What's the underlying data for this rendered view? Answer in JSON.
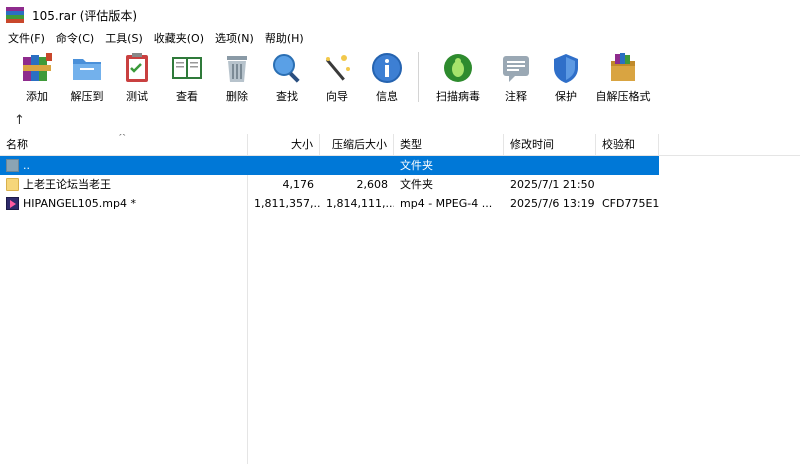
{
  "window": {
    "title": "105.rar (评估版本)"
  },
  "menu": [
    {
      "label": "文件(F)",
      "name": "menu-file"
    },
    {
      "label": "命令(C)",
      "name": "menu-commands"
    },
    {
      "label": "工具(S)",
      "name": "menu-tools"
    },
    {
      "label": "收藏夹(O)",
      "name": "menu-favorites"
    },
    {
      "label": "选项(N)",
      "name": "menu-options"
    },
    {
      "label": "帮助(H)",
      "name": "menu-help"
    }
  ],
  "toolbar": [
    {
      "label": "添加",
      "icon": "books-add-icon"
    },
    {
      "label": "解压到",
      "icon": "folder-extract-icon"
    },
    {
      "label": "测试",
      "icon": "clipboard-test-icon"
    },
    {
      "label": "查看",
      "icon": "book-view-icon"
    },
    {
      "label": "删除",
      "icon": "trash-icon"
    },
    {
      "label": "查找",
      "icon": "magnifier-icon"
    },
    {
      "label": "向导",
      "icon": "magic-wand-icon"
    },
    {
      "label": "信息",
      "icon": "info-icon"
    },
    {
      "label": "扫描病毒",
      "icon": "bug-scan-icon"
    },
    {
      "label": "注释",
      "icon": "comment-icon"
    },
    {
      "label": "保护",
      "icon": "shield-icon"
    },
    {
      "label": "自解压格式",
      "icon": "sfx-box-icon"
    }
  ],
  "columns": {
    "name": "名称",
    "size": "大小",
    "packed": "压缩后大小",
    "type": "类型",
    "modified": "修改时间",
    "crc": "校验和"
  },
  "files": [
    {
      "name": "..",
      "size": "",
      "packed": "",
      "type": "文件夹",
      "modified": "",
      "crc": "",
      "icon": "folder-up-icon",
      "selected": true
    },
    {
      "name": "上老王论坛当老王",
      "size": "4,176",
      "packed": "2,608",
      "type": "文件夹",
      "modified": "2025/7/1 21:50",
      "crc": "",
      "icon": "folder-icon",
      "selected": false
    },
    {
      "name": "HIPANGEL105.mp4 *",
      "size": "1,811,357,...",
      "packed": "1,814,111,...",
      "type": "mp4 - MPEG-4 ...",
      "modified": "2025/7/6 13:19",
      "crc": "CFD775E1",
      "icon": "video-file-icon",
      "selected": false
    }
  ],
  "colors": {
    "selection": "#0078d7"
  }
}
